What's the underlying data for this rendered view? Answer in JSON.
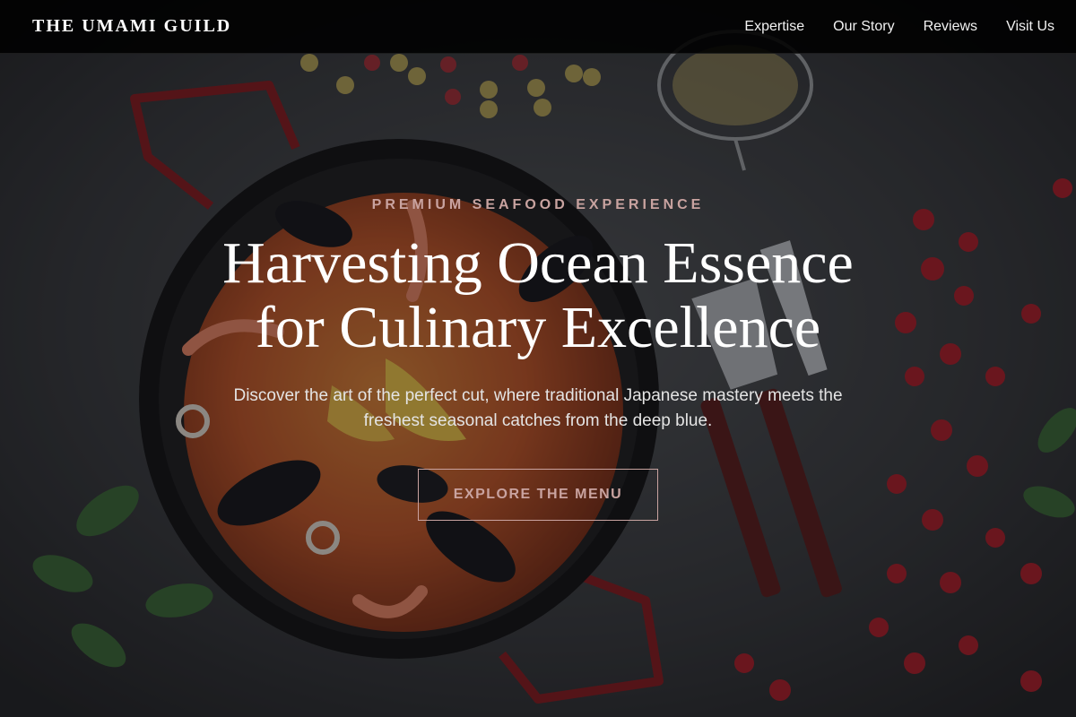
{
  "brand": {
    "name": "THE UMAMI GUILD"
  },
  "nav": {
    "links": [
      {
        "label": "Expertise"
      },
      {
        "label": "Our Story"
      },
      {
        "label": "Reviews"
      },
      {
        "label": "Visit Us"
      }
    ]
  },
  "hero": {
    "eyebrow": "PREMIUM SEAFOOD EXPERIENCE",
    "headline_line1": "Harvesting Ocean Essence",
    "headline_line2": "for Culinary Excellence",
    "subtext": "Discover the art of the perfect cut, where traditional Japanese mastery meets the freshest seasonal catches from the deep blue.",
    "cta_label": "EXPLORE THE MENU"
  },
  "colors": {
    "accent": "#c9a3a0",
    "nav_background": "#000000",
    "text_primary": "#ffffff"
  }
}
